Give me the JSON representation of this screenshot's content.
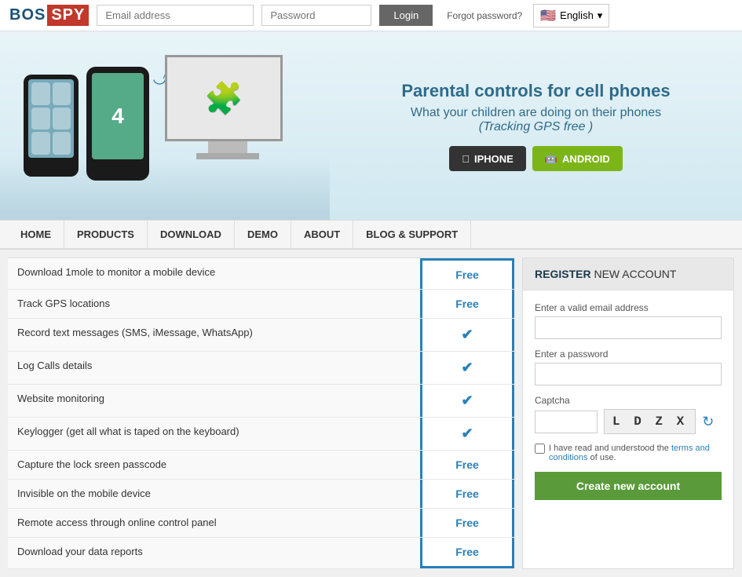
{
  "header": {
    "logo_bos": "BOS",
    "logo_spy": "SPY",
    "email_placeholder": "Email address",
    "password_placeholder": "Password",
    "login_label": "Login",
    "forgot_password": "Forgot password?",
    "language": "English"
  },
  "hero": {
    "title": "Parental controls for cell phones",
    "subtitle": "What your children are doing on their phones",
    "tracking": "(Tracking GPS free )",
    "phone_number": "4",
    "iphone_label": "IPHONE",
    "android_label": "ANDROID"
  },
  "nav": {
    "items": [
      "HOME",
      "PRODUCTS",
      "DOWNLOAD",
      "DEMO",
      "ABOUT",
      "BLOG & SUPPORT"
    ]
  },
  "features": {
    "rows": [
      {
        "name": "Download 1mole to monitor a mobile device",
        "value": "Free",
        "is_check": false
      },
      {
        "name": "Track GPS locations",
        "value": "Free",
        "is_check": false
      },
      {
        "name": "Record text messages (SMS, iMessage, WhatsApp)",
        "value": "✓",
        "is_check": true
      },
      {
        "name": "Log Calls details",
        "value": "✓",
        "is_check": true
      },
      {
        "name": "Website monitoring",
        "value": "✓",
        "is_check": true
      },
      {
        "name": "Keylogger (get all what is taped on the keyboard)",
        "value": "✓",
        "is_check": true
      },
      {
        "name": "Capture the lock sreen passcode",
        "value": "Free",
        "is_check": false
      },
      {
        "name": "Invisible on the mobile device",
        "value": "Free",
        "is_check": false
      },
      {
        "name": "Remote access through online control panel",
        "value": "Free",
        "is_check": false
      },
      {
        "name": "Download your data reports",
        "value": "Free",
        "is_check": false
      }
    ]
  },
  "register": {
    "header_register": "REGISTER",
    "header_rest": "NEW ACCOUNT",
    "email_label": "Enter a valid email address",
    "password_label": "Enter a password",
    "captcha_label": "Captcha",
    "captcha_text": "L D Z X",
    "captcha_refresh": "↻",
    "terms_text": "I have read and understood the ",
    "terms_link": "terms and conditions",
    "terms_rest": " of use.",
    "create_account_label": "Create new account"
  }
}
